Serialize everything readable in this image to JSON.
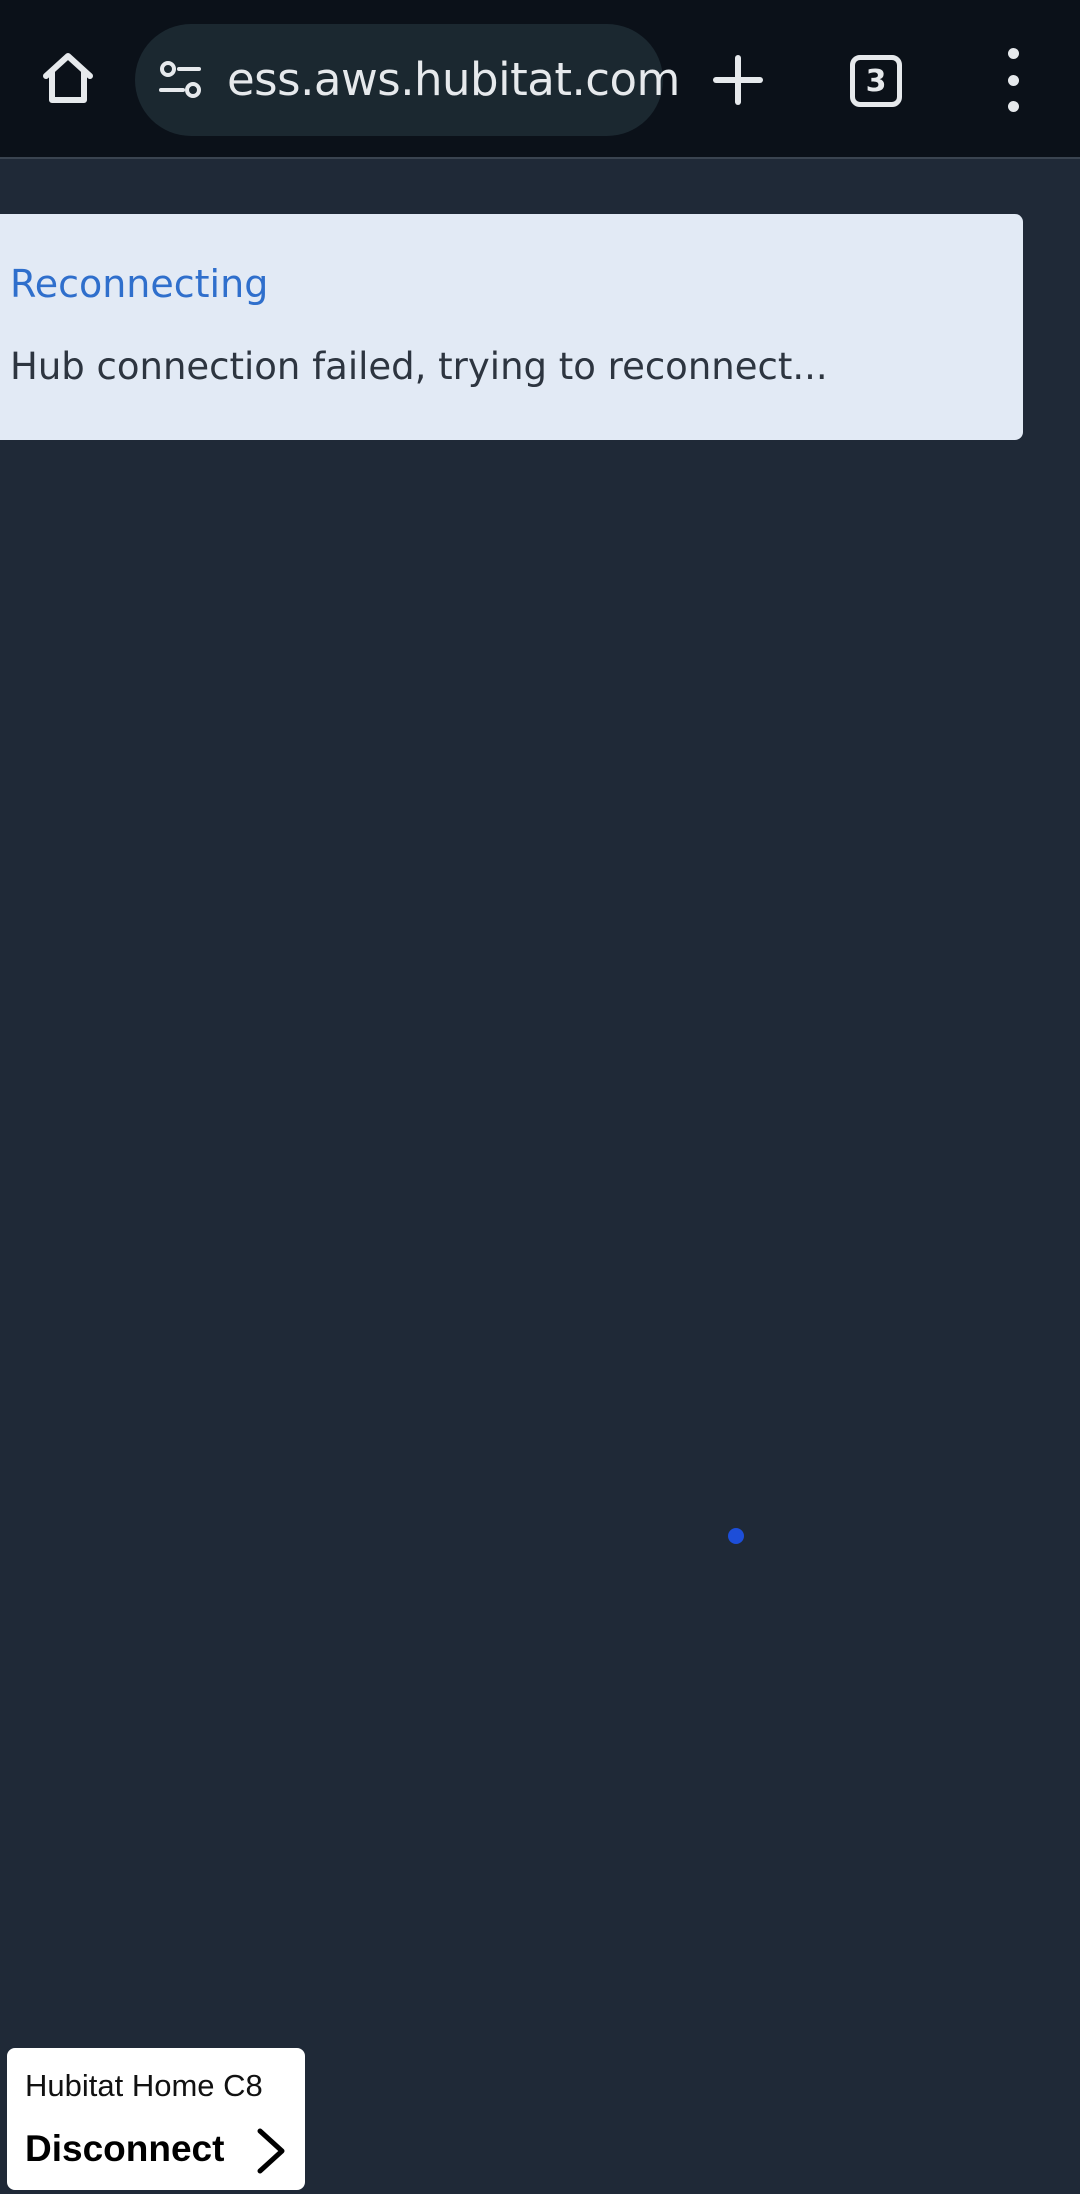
{
  "browser": {
    "url": "ess.aws.hubitat.com",
    "tab_count": "3",
    "icons": {
      "home": "home-icon",
      "site_settings": "site-settings-icon",
      "new_tab": "plus-icon",
      "tabs": "tab-switcher-icon",
      "menu": "more-vertical-icon"
    }
  },
  "alert": {
    "title": "Reconnecting",
    "message": "Hub connection failed, trying to reconnect..."
  },
  "hub": {
    "name": "Hubitat Home C8",
    "action": "Disconnect"
  },
  "colors": {
    "page_background": "#1f2937",
    "toolbar_background": "#0b1119",
    "url_pill": "#1b2830",
    "alert_background": "#e2eaf5",
    "alert_title": "#2f6fcc",
    "loading_dot": "#1d4ed8"
  }
}
